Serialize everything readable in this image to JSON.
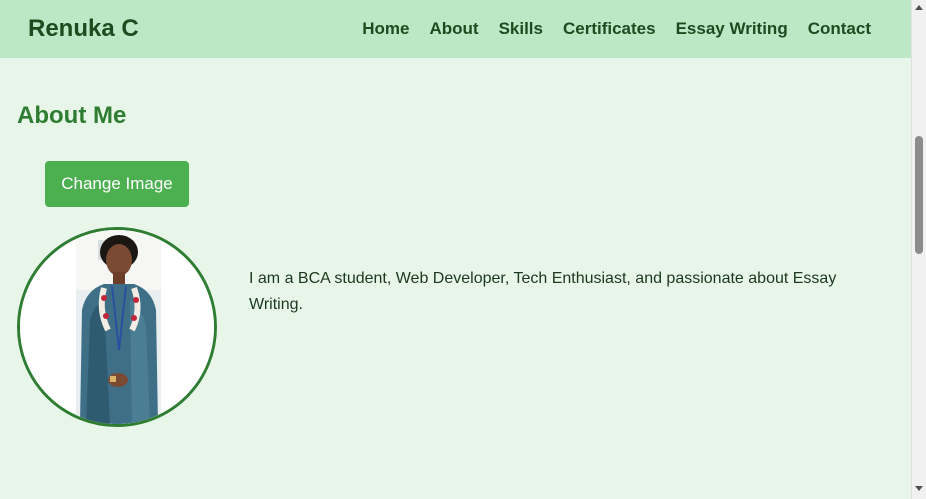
{
  "header": {
    "brand": "Renuka C",
    "nav": [
      {
        "label": "Home"
      },
      {
        "label": "About"
      },
      {
        "label": "Skills"
      },
      {
        "label": "Certificates"
      },
      {
        "label": "Essay Writing"
      },
      {
        "label": "Contact"
      }
    ]
  },
  "about": {
    "title": "About Me",
    "change_image_label": "Change Image",
    "bio": "I am a BCA student, Web Developer, Tech Enthusiast, and passionate about Essay Writing."
  },
  "colors": {
    "background": "#e8f5e9",
    "navbar": "#bde8c6",
    "accent": "#4caf50",
    "heading": "#2e7d32"
  }
}
